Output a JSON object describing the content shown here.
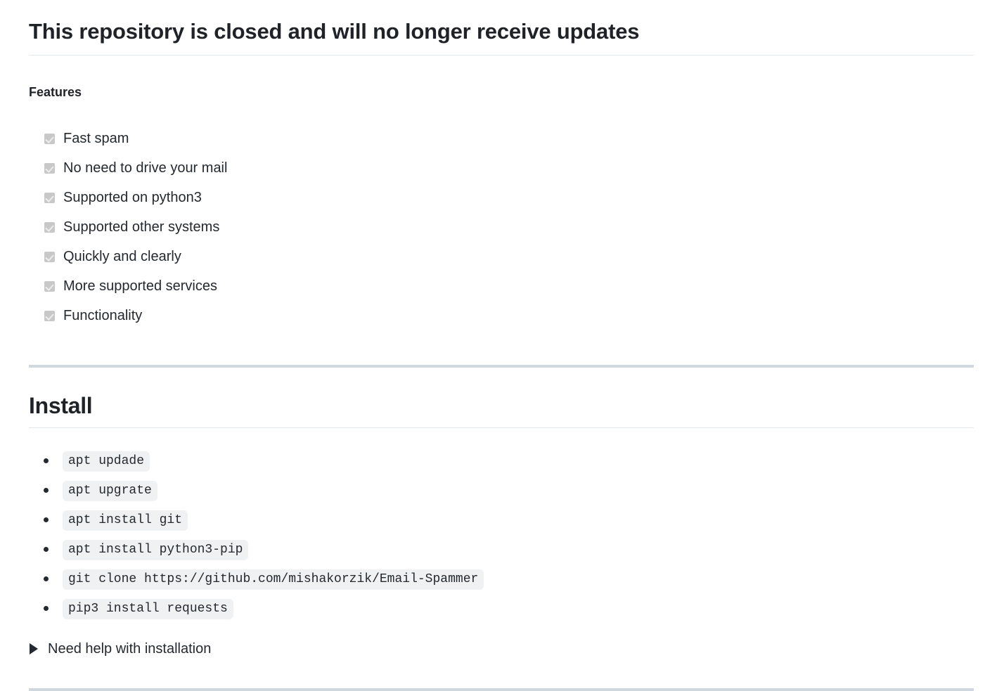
{
  "document": {
    "title": "This repository is closed and will no longer receive updates"
  },
  "features_section": {
    "heading": "Features",
    "items": [
      {
        "label": "Fast spam",
        "checked": true
      },
      {
        "label": "No need to drive your mail",
        "checked": true
      },
      {
        "label": "Supported on python3",
        "checked": true
      },
      {
        "label": "Supported other systems",
        "checked": true
      },
      {
        "label": "Quickly and clearly",
        "checked": true
      },
      {
        "label": "More supported services",
        "checked": true
      },
      {
        "label": "Functionality",
        "checked": true
      }
    ]
  },
  "install_section": {
    "heading": "Install",
    "commands": [
      "apt updade",
      "apt upgrate",
      "apt install git",
      "apt install python3-pip",
      "git clone https://github.com/mishakorzik/Email-Spammer",
      "pip3 install requests"
    ],
    "details": {
      "summary": "Need help with installation",
      "marker_icon": "triangle-right-icon",
      "expanded": false
    }
  },
  "colors": {
    "text": "#24292f",
    "heading": "#1f2328",
    "thin_rule": "#e3e8ed",
    "thick_rule": "#d0d7de",
    "code_background": "#eff1f3",
    "checkbox_fill": "#c8c8c8",
    "checkbox_check": "#ededed",
    "page_background": "#ffffff"
  }
}
